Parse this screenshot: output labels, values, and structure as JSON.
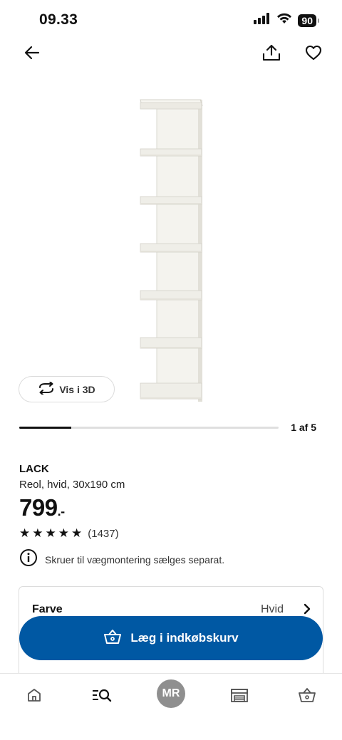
{
  "status_bar": {
    "time": "09.33",
    "battery": "90",
    "icons": [
      "signal-icon",
      "wifi-icon",
      "battery-icon"
    ]
  },
  "top_bar": {
    "icons": [
      "back-arrow-icon",
      "share-icon",
      "heart-icon"
    ]
  },
  "gallery": {
    "view_3d_label": "Vis i 3D",
    "counter": "1 af 5",
    "current": 1,
    "total": 5,
    "progress_fraction": 0.2
  },
  "product": {
    "name": "LACK",
    "description": "Reol, hvid, 30x190 cm",
    "price": "799",
    "price_suffix": ".-",
    "rating_stars": 5,
    "review_count": "(1437)",
    "note": "Skruer til vægmontering sælges separat."
  },
  "options": {
    "color_label": "Farve",
    "color_value": "Hvid"
  },
  "cart_button": {
    "label": "Læg i indkøbskurv"
  },
  "bottom_nav": {
    "items": [
      "home-icon",
      "search-icon",
      "profile-avatar",
      "store-icon",
      "cart-icon"
    ],
    "avatar_initials": "MR"
  },
  "colors": {
    "accent": "#0058a3",
    "avatar": "#8f8f8f",
    "text": "#111111"
  }
}
